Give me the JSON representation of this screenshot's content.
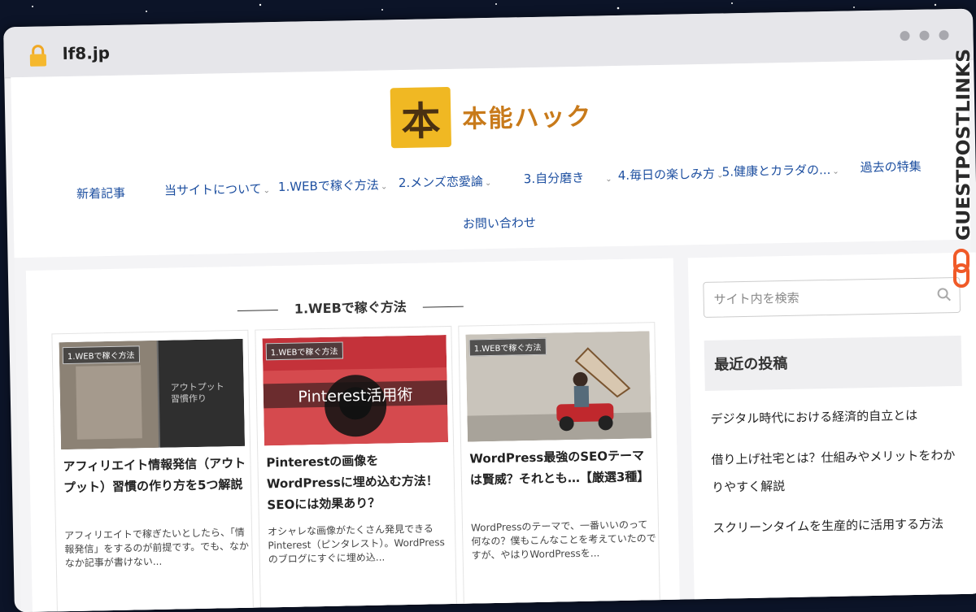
{
  "browser": {
    "url": "lf8.jp"
  },
  "logo": {
    "mark": "本",
    "text": "本能ハック"
  },
  "nav": {
    "items": [
      {
        "label": "新着記事"
      },
      {
        "label": "当サイトについて"
      },
      {
        "label": "1.WEBで稼ぐ方法"
      },
      {
        "label": "2.メンズ恋愛論"
      },
      {
        "label": "3.自分磨き"
      },
      {
        "label": "4.毎日の楽しみ方"
      },
      {
        "label": "5.健康とカラダの..."
      },
      {
        "label": "過去の特集"
      },
      {
        "label": "お問い合わせ"
      }
    ]
  },
  "section": {
    "title": "1.WEBで稼ぐ方法"
  },
  "cards": [
    {
      "tag": "1.WEBで稼ぐ方法",
      "thumb_text": "アウトプット\n習慣作り",
      "title": "アフィリエイト情報発信（アウトプット）習慣の作り方を5つ解説",
      "excerpt": "アフィリエイトで稼ぎたいとしたら、「情報発信」をするのが前提です。でも、なかなか記事が書けない..."
    },
    {
      "tag": "1.WEBで稼ぐ方法",
      "thumb_text": "Pinterest活用術",
      "title": "Pinterestの画像をWordPressに埋め込む方法！SEOには効果あり？",
      "excerpt": "オシャレな画像がたくさん発見できるPinterest（ピンタレスト）。WordPressのブログにすぐに埋め込..."
    },
    {
      "tag": "1.WEBで稼ぐ方法",
      "thumb_text": "",
      "title": "WordPress最強のSEOテーマは賢威？それとも…【厳選3種】",
      "excerpt": "WordPressのテーマで、一番いいのって何なの？僕もこんなことを考えていたのですが、やはりWordPressを..."
    }
  ],
  "sidebar": {
    "search_placeholder": "サイト内を検索",
    "widget_title": "最近の投稿",
    "posts": [
      "デジタル時代における経済的自立とは",
      "借り上げ社宅とは？仕組みやメリットをわかりやすく解説",
      "スクリーンタイムを生産的に活用する方法"
    ]
  },
  "watermark": {
    "text": "GUESTPOSTLINKS"
  },
  "colors": {
    "nav_link": "#1d4fa0",
    "logo_box": "#f0b823",
    "logo_text": "#c87a1a",
    "watermark": "#2a2a2a",
    "watermark_accent": "#f05a28"
  }
}
